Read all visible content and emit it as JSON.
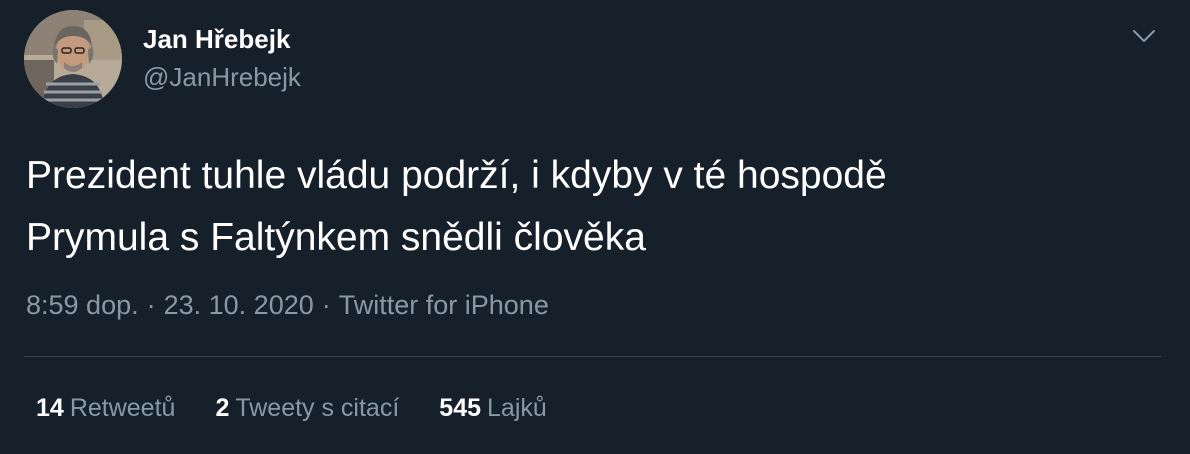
{
  "author": {
    "display_name": "Jan Hřebejk",
    "handle": "@JanHrebejk"
  },
  "tweet": {
    "text_line1": "Prezident tuhle vládu podrží, i kdyby v té hospodě",
    "text_line2": "Prymula s Faltýnkem snědli člověka"
  },
  "meta": {
    "time": "8:59 dop.",
    "separator": "·",
    "date": "23. 10. 2020",
    "source": "Twitter for iPhone"
  },
  "stats": {
    "retweets_count": "14",
    "retweets_label": "Retweetů",
    "quotes_count": "2",
    "quotes_label": "Tweety s citací",
    "likes_count": "545",
    "likes_label": "Lajků"
  },
  "icons": {
    "menu": "chevron-down-icon"
  },
  "colors": {
    "background": "#15202b",
    "secondary_text": "#8899a6",
    "divider": "#38444d"
  }
}
